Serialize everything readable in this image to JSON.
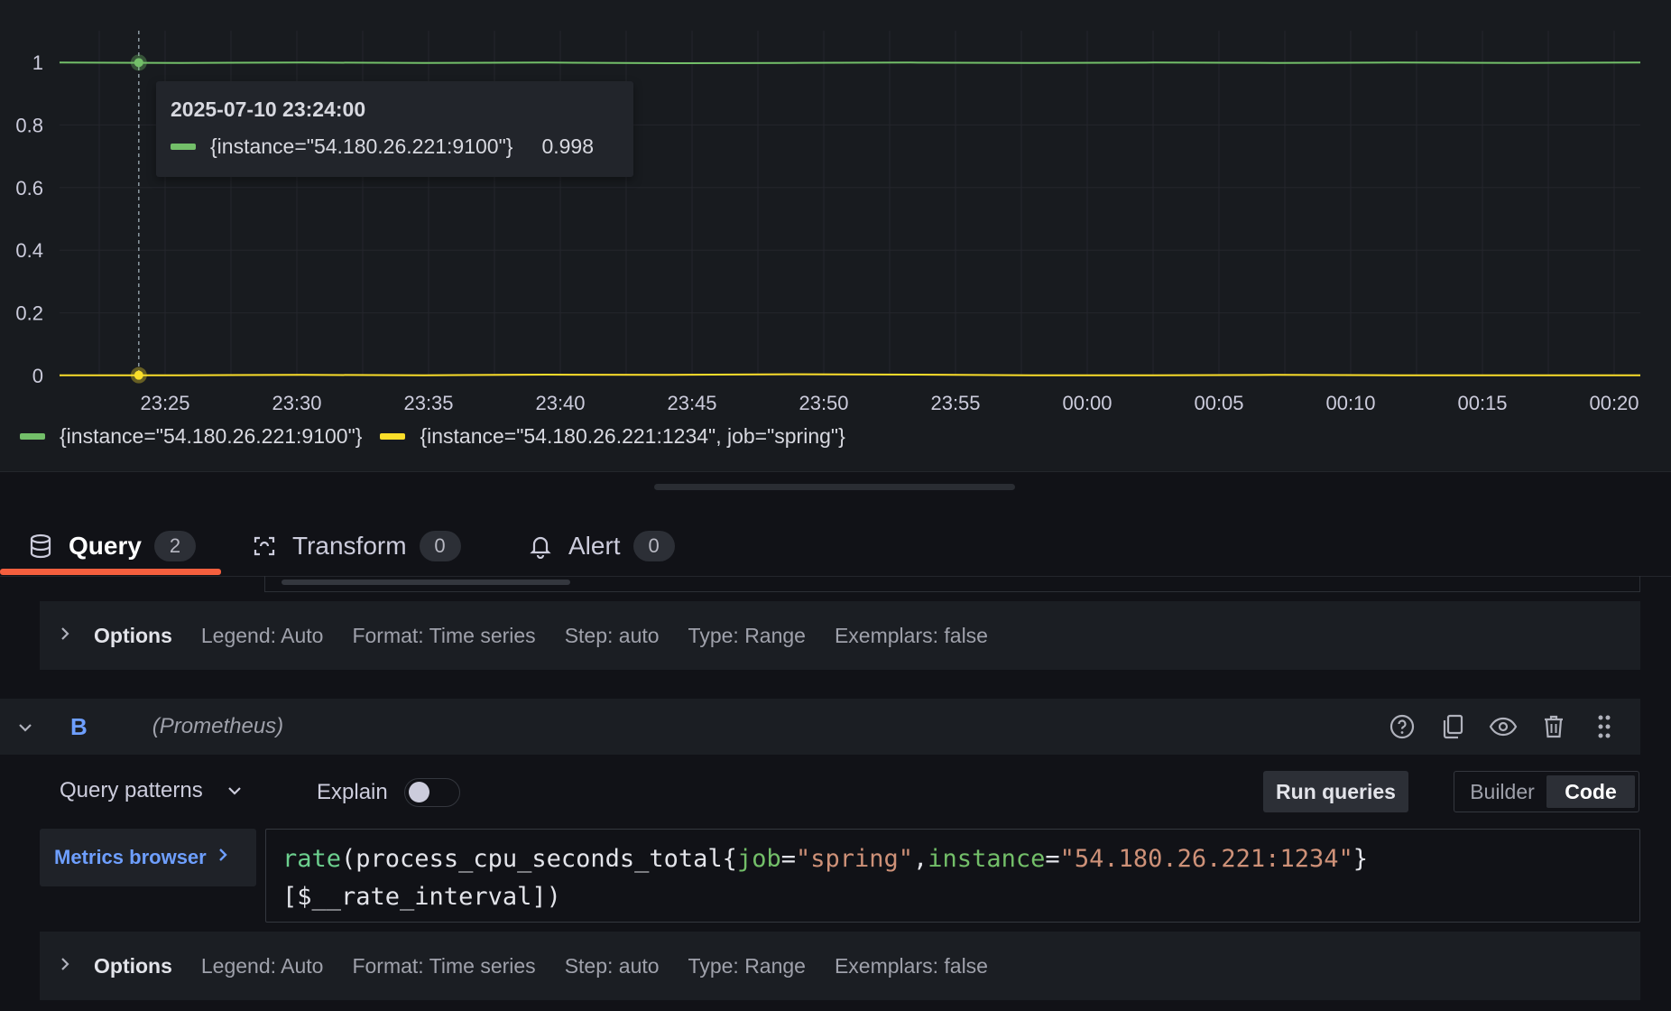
{
  "colors": {
    "series_green": "#73bf69",
    "series_yellow": "#fade2a",
    "accent_tab": "#f55f3e",
    "link_blue": "#6e9fff"
  },
  "chart_data": {
    "type": "line",
    "yticks": [
      "0",
      "0.2",
      "0.4",
      "0.6",
      "0.8",
      "1"
    ],
    "ylim": [
      0,
      1.0
    ],
    "xticks": [
      "23:25",
      "23:30",
      "23:35",
      "23:40",
      "23:45",
      "23:50",
      "23:55",
      "00:00",
      "00:05",
      "00:10",
      "00:15",
      "00:20"
    ],
    "grid": true,
    "legend_position": "bottom-left",
    "series": [
      {
        "name": "{instance=\"54.180.26.221:9100\"}",
        "color": "#73bf69",
        "values": [
          0.999,
          0.998,
          0.999,
          0.998,
          0.999,
          0.997,
          0.998,
          0.999,
          0.998,
          0.999,
          0.998,
          0.999,
          0.998,
          0.999
        ]
      },
      {
        "name": "{instance=\"54.180.26.221:1234\", job=\"spring\"}",
        "color": "#fade2a",
        "values": [
          0.001,
          0.001,
          0.002,
          0.001,
          0.003,
          0.002,
          0.004,
          0.003,
          0.001,
          0.001,
          0.002,
          0.001,
          0.001,
          0.001
        ]
      }
    ],
    "hover_time_label": "23:24"
  },
  "tooltip": {
    "time": "2025-07-10 23:24:00",
    "series": "{instance=\"54.180.26.221:9100\"}",
    "value": "0.998"
  },
  "legend": [
    {
      "label": "{instance=\"54.180.26.221:9100\"}",
      "color": "#73bf69"
    },
    {
      "label": "{instance=\"54.180.26.221:1234\", job=\"spring\"}",
      "color": "#fade2a"
    }
  ],
  "tabs": [
    {
      "label": "Query",
      "count": "2",
      "icon": "database-icon",
      "active": true
    },
    {
      "label": "Transform",
      "count": "0",
      "icon": "transform-icon",
      "active": false
    },
    {
      "label": "Alert",
      "count": "0",
      "icon": "bell-icon",
      "active": false
    }
  ],
  "options": {
    "title": "Options",
    "legend": "Legend: Auto",
    "format": "Format: Time series",
    "step": "Step: auto",
    "type": "Type: Range",
    "exemplars": "Exemplars: false"
  },
  "query_b": {
    "ref_id": "B",
    "datasource": "(Prometheus)",
    "query_patterns": "Query patterns",
    "explain": "Explain",
    "run_queries": "Run queries",
    "mode_builder": "Builder",
    "mode_code": "Code",
    "metrics_browser": "Metrics browser",
    "code_tokens": {
      "fn": "rate",
      "p1": "(process_cpu_seconds_total{",
      "k1": "job",
      "eq1": "=",
      "v1": "\"spring\"",
      "comma": ",",
      "k2": "instance",
      "eq2": "=",
      "v2": "\"54.180.26.221:1234\"",
      "close": "}",
      "line2": "[$__rate_interval])"
    }
  }
}
